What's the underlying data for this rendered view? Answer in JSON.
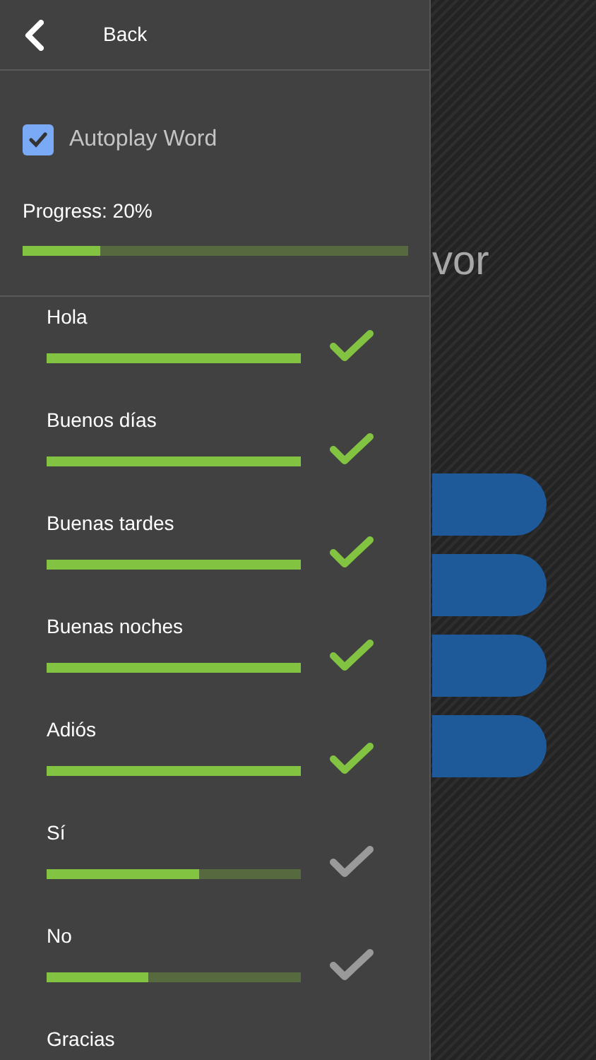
{
  "header": {
    "back_label": "Back"
  },
  "autoplay": {
    "label": "Autoplay Word",
    "checked": true
  },
  "progress": {
    "label": "Progress: 20%",
    "level": 0.2
  },
  "background": {
    "title_fragment": "vor"
  },
  "words": [
    {
      "label": "Hola",
      "level": 1,
      "learned": true
    },
    {
      "label": "Buenos días",
      "level": 1,
      "learned": true
    },
    {
      "label": "Buenas tardes",
      "level": 1,
      "learned": true
    },
    {
      "label": "Buenas noches",
      "level": 1,
      "learned": true
    },
    {
      "label": "Adiós",
      "level": 1,
      "learned": true
    },
    {
      "label": "Sí",
      "level": 0.6,
      "learned": false
    },
    {
      "label": "No",
      "level": 0.4,
      "learned": false
    },
    {
      "label": "Gracias"
    }
  ]
}
